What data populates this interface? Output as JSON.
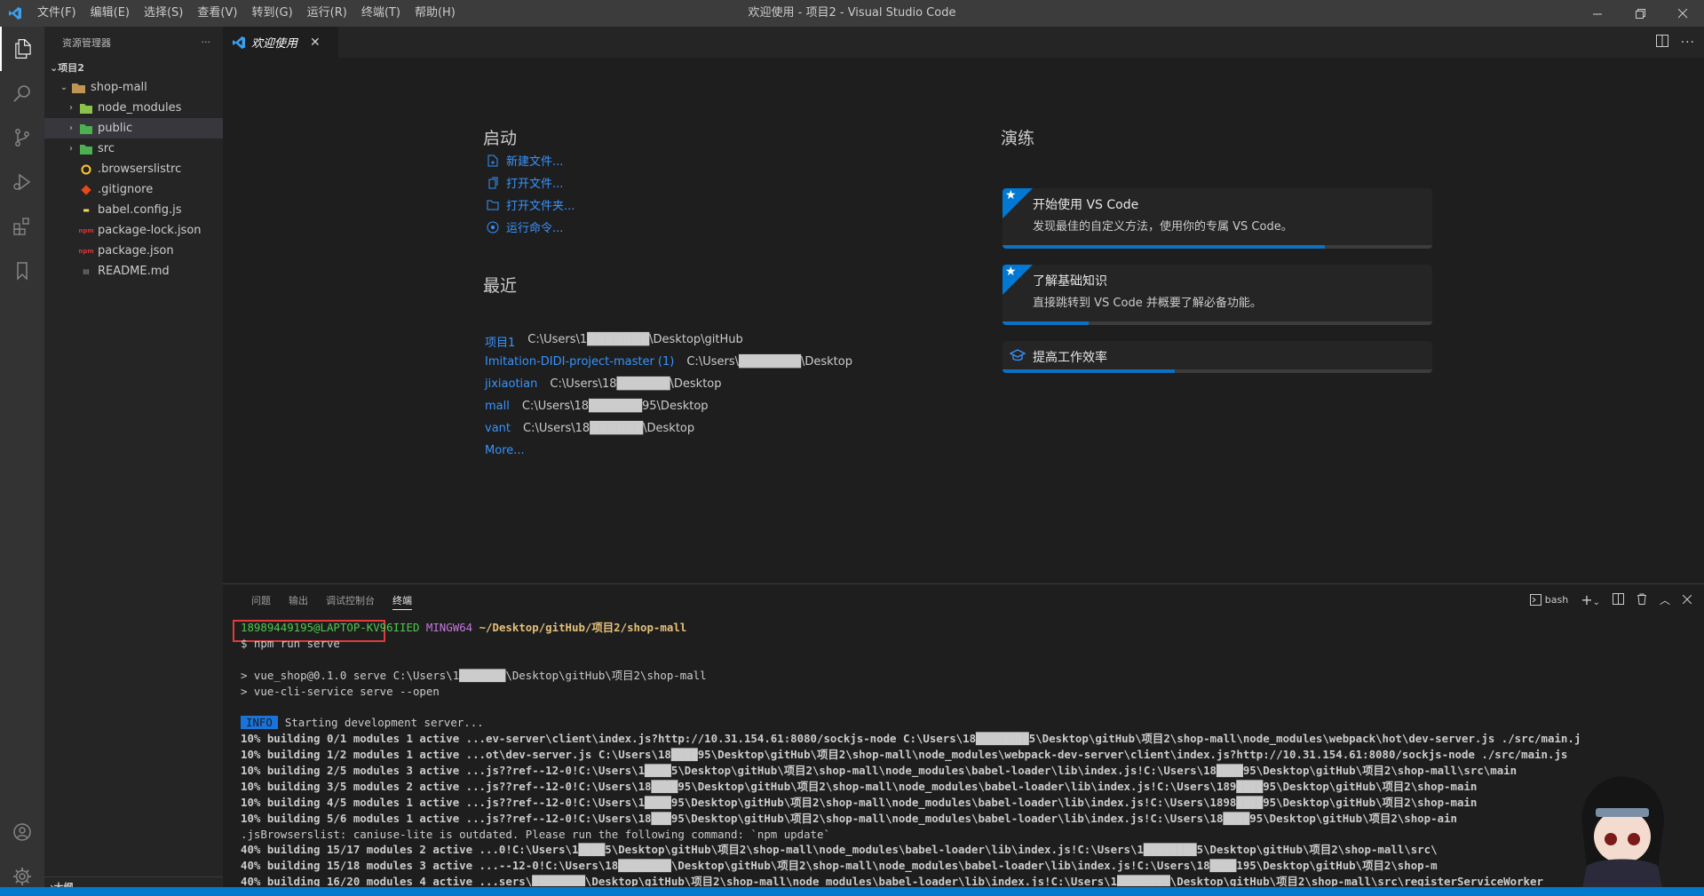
{
  "window": {
    "title": "欢迎使用 - 项目2 - Visual Studio Code",
    "menu": [
      "文件(F)",
      "编辑(E)",
      "选择(S)",
      "查看(V)",
      "转到(G)",
      "运行(R)",
      "终端(T)",
      "帮助(H)"
    ]
  },
  "activity_bar": {
    "items": [
      "files-icon",
      "search-icon",
      "source-control-icon",
      "run-debug-icon",
      "extensions-icon",
      "bookmark-icon"
    ],
    "bottom": [
      "account-icon",
      "settings-gear-icon"
    ]
  },
  "explorer": {
    "title": "资源管理器",
    "more": "···",
    "workspace": "项目2",
    "root": "shop-mall",
    "items": [
      {
        "label": "node_modules",
        "type": "folder"
      },
      {
        "label": "public",
        "type": "folder"
      },
      {
        "label": "src",
        "type": "folder"
      },
      {
        "label": ".browserslistrc",
        "type": "file"
      },
      {
        "label": ".gitignore",
        "type": "file"
      },
      {
        "label": "babel.config.js",
        "type": "file"
      },
      {
        "label": "package-lock.json",
        "type": "file"
      },
      {
        "label": "package.json",
        "type": "file"
      },
      {
        "label": "README.md",
        "type": "file"
      }
    ],
    "outline": "大纲"
  },
  "tab": {
    "label": "欢迎使用",
    "close": "✕"
  },
  "welcome": {
    "start": {
      "heading": "启动",
      "links": [
        "新建文件...",
        "打开文件...",
        "打开文件夹...",
        "运行命令..."
      ]
    },
    "recent": {
      "heading": "最近",
      "items": [
        {
          "name": "项目1",
          "path": "C:\\Users\\1███████\\Desktop\\gitHub"
        },
        {
          "name": "Imitation-DIDI-project-master (1)",
          "path": "C:\\Users\\███████\\Desktop"
        },
        {
          "name": "jixiaotian",
          "path": "C:\\Users\\18██████\\Desktop"
        },
        {
          "name": "mall",
          "path": "C:\\Users\\18██████95\\Desktop"
        },
        {
          "name": "vant",
          "path": "C:\\Users\\18██████\\Desktop"
        }
      ],
      "more": "More..."
    },
    "walkthroughs": {
      "heading": "演练",
      "cards": [
        {
          "title": "开始使用 VS Code",
          "desc": "发现最佳的自定义方法，使用你的专属 VS Code。",
          "progress": 0.75
        },
        {
          "title": "了解基础知识",
          "desc": "直接跳转到 VS Code 并概要了解必备功能。",
          "progress": 0.2
        },
        {
          "title": "提高工作效率",
          "desc": "",
          "progress": 0.4
        }
      ]
    }
  },
  "panel": {
    "tabs": [
      "问题",
      "输出",
      "调试控制台",
      "终端"
    ],
    "active_tab": "终端",
    "shell": "bash",
    "terminal": {
      "prompt_user": "18989449195@LAPTOP-KV96IIED",
      "prompt_env": "MINGW64",
      "prompt_path": "~/Desktop/gitHub/项目2/shop-mall",
      "command": "$ npm run serve",
      "lines": [
        "> vue_shop@0.1.0 serve C:\\Users\\1███████\\Desktop\\gitHub\\项目2\\shop-mall",
        "> vue-cli-service serve --open"
      ],
      "info_badge": "INFO",
      "info_text": "Starting development server...",
      "build_lines": [
        "10% building 0/1 modules 1 active ...ev-server\\client\\index.js?http://10.31.154.61:8080/sockjs-node C:\\Users\\18████████5\\Desktop\\gitHub\\项目2\\shop-mall\\node_modules\\webpack\\hot\\dev-server.js ./src/main.j",
        "10% building 1/2 modules 1 active ...ot\\dev-server.js C:\\Users\\18████95\\Desktop\\gitHub\\项目2\\shop-mall\\node_modules\\webpack-dev-server\\client\\index.js?http://10.31.154.61:8080/sockjs-node ./src/main.js",
        "10% building 2/5 modules 3 active ...js??ref--12-0!C:\\Users\\1████5\\Desktop\\gitHub\\项目2\\shop-mall\\node_modules\\babel-loader\\lib\\index.js!C:\\Users\\18████95\\Desktop\\gitHub\\项目2\\shop-mall\\src\\main",
        "10% building 3/5 modules 2 active ...js??ref--12-0!C:\\Users\\18████95\\Desktop\\gitHub\\项目2\\shop-mall\\node_modules\\babel-loader\\lib\\index.js!C:\\Users\\189████95\\Desktop\\gitHub\\项目2\\shop-main",
        "10% building 4/5 modules 1 active ...js??ref--12-0!C:\\Users\\1████95\\Desktop\\gitHub\\项目2\\shop-mall\\node_modules\\babel-loader\\lib\\index.js!C:\\Users\\1898████95\\Desktop\\gitHub\\项目2\\shop-main",
        "10% building 5/6 modules 1 active ...js??ref--12-0!C:\\Users\\18███95\\Desktop\\gitHub\\项目2\\shop-mall\\node_modules\\babel-loader\\lib\\index.js!C:\\Users\\18████95\\Desktop\\gitHub\\项目2\\shop-ain",
        ".jsBrowserslist: caniuse-lite is outdated. Please run the following command: `npm update`",
        "40% building 15/17 modules 2 active ...0!C:\\Users\\1████5\\Desktop\\gitHub\\项目2\\shop-mall\\node_modules\\babel-loader\\lib\\index.js!C:\\Users\\1████████5\\Desktop\\gitHub\\项目2\\shop-mall\\src\\",
        "40% building 15/18 modules 3 active ...--12-0!C:\\Users\\18████████\\Desktop\\gitHub\\项目2\\shop-mall\\node_modules\\babel-loader\\lib\\index.js!C:\\Users\\18████195\\Desktop\\gitHub\\项目2\\shop-m",
        "40% building 16/20 modules 4 active ...sers\\████████\\Desktop\\gitHub\\项目2\\shop-mall\\node_modules\\babel-loader\\lib\\index.js!C:\\Users\\1████████\\Desktop\\gitHub\\项目2\\shop-mall\\src\\registerServiceWorker"
      ]
    }
  }
}
